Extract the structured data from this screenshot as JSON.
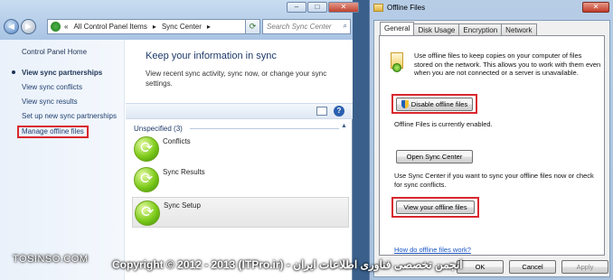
{
  "sync_center": {
    "address_bar": {
      "chevron": "«",
      "segments": [
        "All Control Panel Items",
        "Sync Center"
      ],
      "separator": "▸"
    },
    "search_placeholder": "Search Sync Center",
    "window_buttons": [
      "–",
      "□",
      "✕"
    ],
    "sidebar": {
      "home": "Control Panel Home",
      "current": "View sync partnerships",
      "items": [
        "View sync conflicts",
        "View sync results",
        "Set up new sync partnerships",
        "Manage offline files"
      ]
    },
    "header": {
      "title": "Keep your information in sync",
      "description": "View recent sync activity, sync now, or change your sync settings."
    },
    "group": {
      "label": "Unspecified (3)"
    },
    "items": [
      "Conflicts",
      "Sync Results",
      "Sync Setup"
    ]
  },
  "offline_files": {
    "title": "Offline Files",
    "close": "✕",
    "tabs": [
      "General",
      "Disk Usage",
      "Encryption",
      "Network"
    ],
    "description": "Use offline files to keep copies on your computer of files stored on the network. This allows you to work with them even when you are not connected or a server is unavailable.",
    "disable_button": "Disable offline files",
    "status": "Offline Files is currently enabled.",
    "open_sync_center": "Open Sync Center",
    "sync_text": "Use Sync Center if you want to sync your offline files now or check for sync conflicts.",
    "view_files_button": "View your offline files",
    "help_link": "How do offline files work?",
    "ok": "OK",
    "cancel": "Cancel",
    "apply": "Apply"
  },
  "watermark": {
    "site": "TOSINSO.COM",
    "copyright": "Copyright © 2012 - 2013 (ITPro.ir) - انجمن تخصصی فناوری اطلاعات ایران"
  },
  "colors": {
    "highlight": "#d9272e",
    "link": "#1a56c4",
    "accent": "#1e3a6a"
  }
}
